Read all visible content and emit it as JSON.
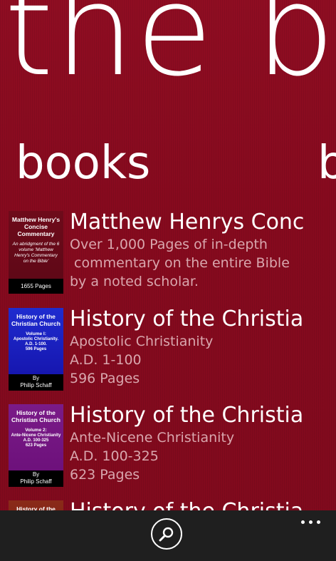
{
  "app": {
    "title": "the bible",
    "pivot_active": "books",
    "pivot_next": "b"
  },
  "books": [
    {
      "title": "Matthew Henrys Concise Commentary",
      "lines": [
        "Over 1,000 Pages of in-depth",
        " commentary on the entire Bible",
        "by a noted scholar."
      ],
      "cover": {
        "title": "Matthew Henry's Concise Commentary",
        "subtitle": "An abridgment of the 6 volume 'Matthew Henry's Commentary on the Bible'",
        "footer": "1655 Pages"
      }
    },
    {
      "title": "History of the Christian Church",
      "lines": [
        "Apostolic Christianity",
        "A.D. 1-100",
        "596 Pages"
      ],
      "cover": {
        "title": "History of the Christian Church",
        "volume": "Volume I:",
        "era": "Apostolic Christianity.",
        "dates": "A.D. 1-100.",
        "pages": "596 Pages",
        "by": "By",
        "author": "Philip Schaff"
      }
    },
    {
      "title": "History of the Christian Church",
      "lines": [
        "Ante-Nicene Christianity",
        "A.D. 100-325",
        "623 Pages"
      ],
      "cover": {
        "title": "History of the Christian Church",
        "volume": "Volume 2:",
        "era": "Ante-Nicene Christianity",
        "dates": "A.D. 100-325",
        "pages": "623 Pages",
        "by": "By",
        "author": "Philip Schaff"
      }
    },
    {
      "title": "History of the Christian Church",
      "cover": {
        "title": "History of the"
      }
    }
  ],
  "appbar": {
    "search_icon": "search-icon",
    "more_icon": "ellipsis-icon"
  },
  "colors": {
    "background": "#8a0a1f",
    "subtext": "#d9a7ae",
    "appbar": "#1f1f1f"
  }
}
